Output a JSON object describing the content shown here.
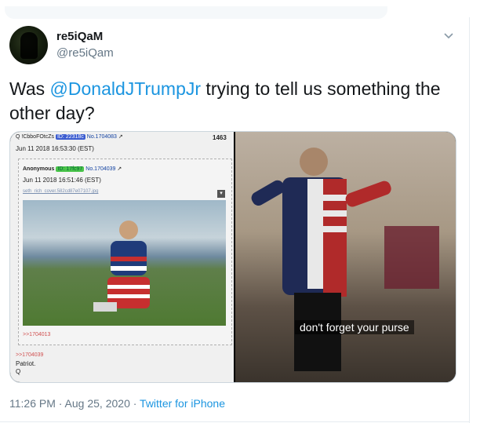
{
  "user": {
    "display_name": "re5iQaM",
    "handle": "@re5iQam"
  },
  "tweet": {
    "text_before": "Was ",
    "mention": "@DonaldJTrumpJr",
    "text_after": " trying to tell us something the other day?",
    "time": "11:26 PM · Aug 25, 2020 · ",
    "source": "Twitter for iPhone"
  },
  "media": {
    "left": {
      "header_name": "Q !CbboFOtcZs",
      "header_id": "ID: 22318c",
      "header_no": "No.1704083",
      "post_count": "1463",
      "date": "Jun 11 2018 16:53:30 (EST)",
      "inner_name": "Anonymous",
      "inner_id": "ID: 17fc97",
      "inner_no": "No.1704039",
      "inner_date": "Jun 11 2018 16:51:46 (EST)",
      "inner_file": "seth_rich_cover.582cd87e07107.jpg",
      "inner_quote": ">>1704013",
      "quote": ">>1704039",
      "text": "Patriot.",
      "sign": "Q"
    },
    "right": {
      "subtitle": "don't forget your purse"
    }
  },
  "icons": {
    "chevron": "chevron-down-icon",
    "external_link": "external-link-icon",
    "download": "download-icon"
  },
  "colors": {
    "link": "#1b95e0",
    "secondary_text": "#657786"
  }
}
